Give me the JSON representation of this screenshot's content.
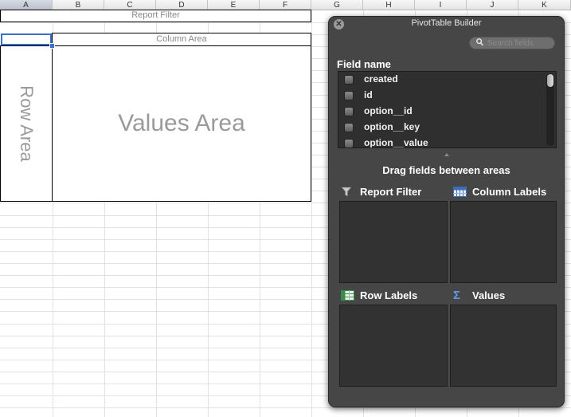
{
  "sheet": {
    "columns": [
      "A",
      "B",
      "C",
      "D",
      "E",
      "F",
      "G",
      "H",
      "I",
      "J",
      "K"
    ],
    "report_filter_label": "Report Filter",
    "column_area_label": "Column Area",
    "row_area_label": "Row Area",
    "values_area_label": "Values Area"
  },
  "panel": {
    "title": "PivotTable Builder",
    "close_symbol": "✕",
    "search_placeholder": "Search fields",
    "field_name_header": "Field name",
    "fields": [
      "created",
      "id",
      "option__id",
      "option__key",
      "option__value"
    ],
    "drag_hint": "Drag fields between areas",
    "areas": {
      "report_filter": "Report Filter",
      "column_labels": "Column Labels",
      "row_labels": "Row Labels",
      "values": "Values"
    },
    "values_symbol": "Σ"
  }
}
